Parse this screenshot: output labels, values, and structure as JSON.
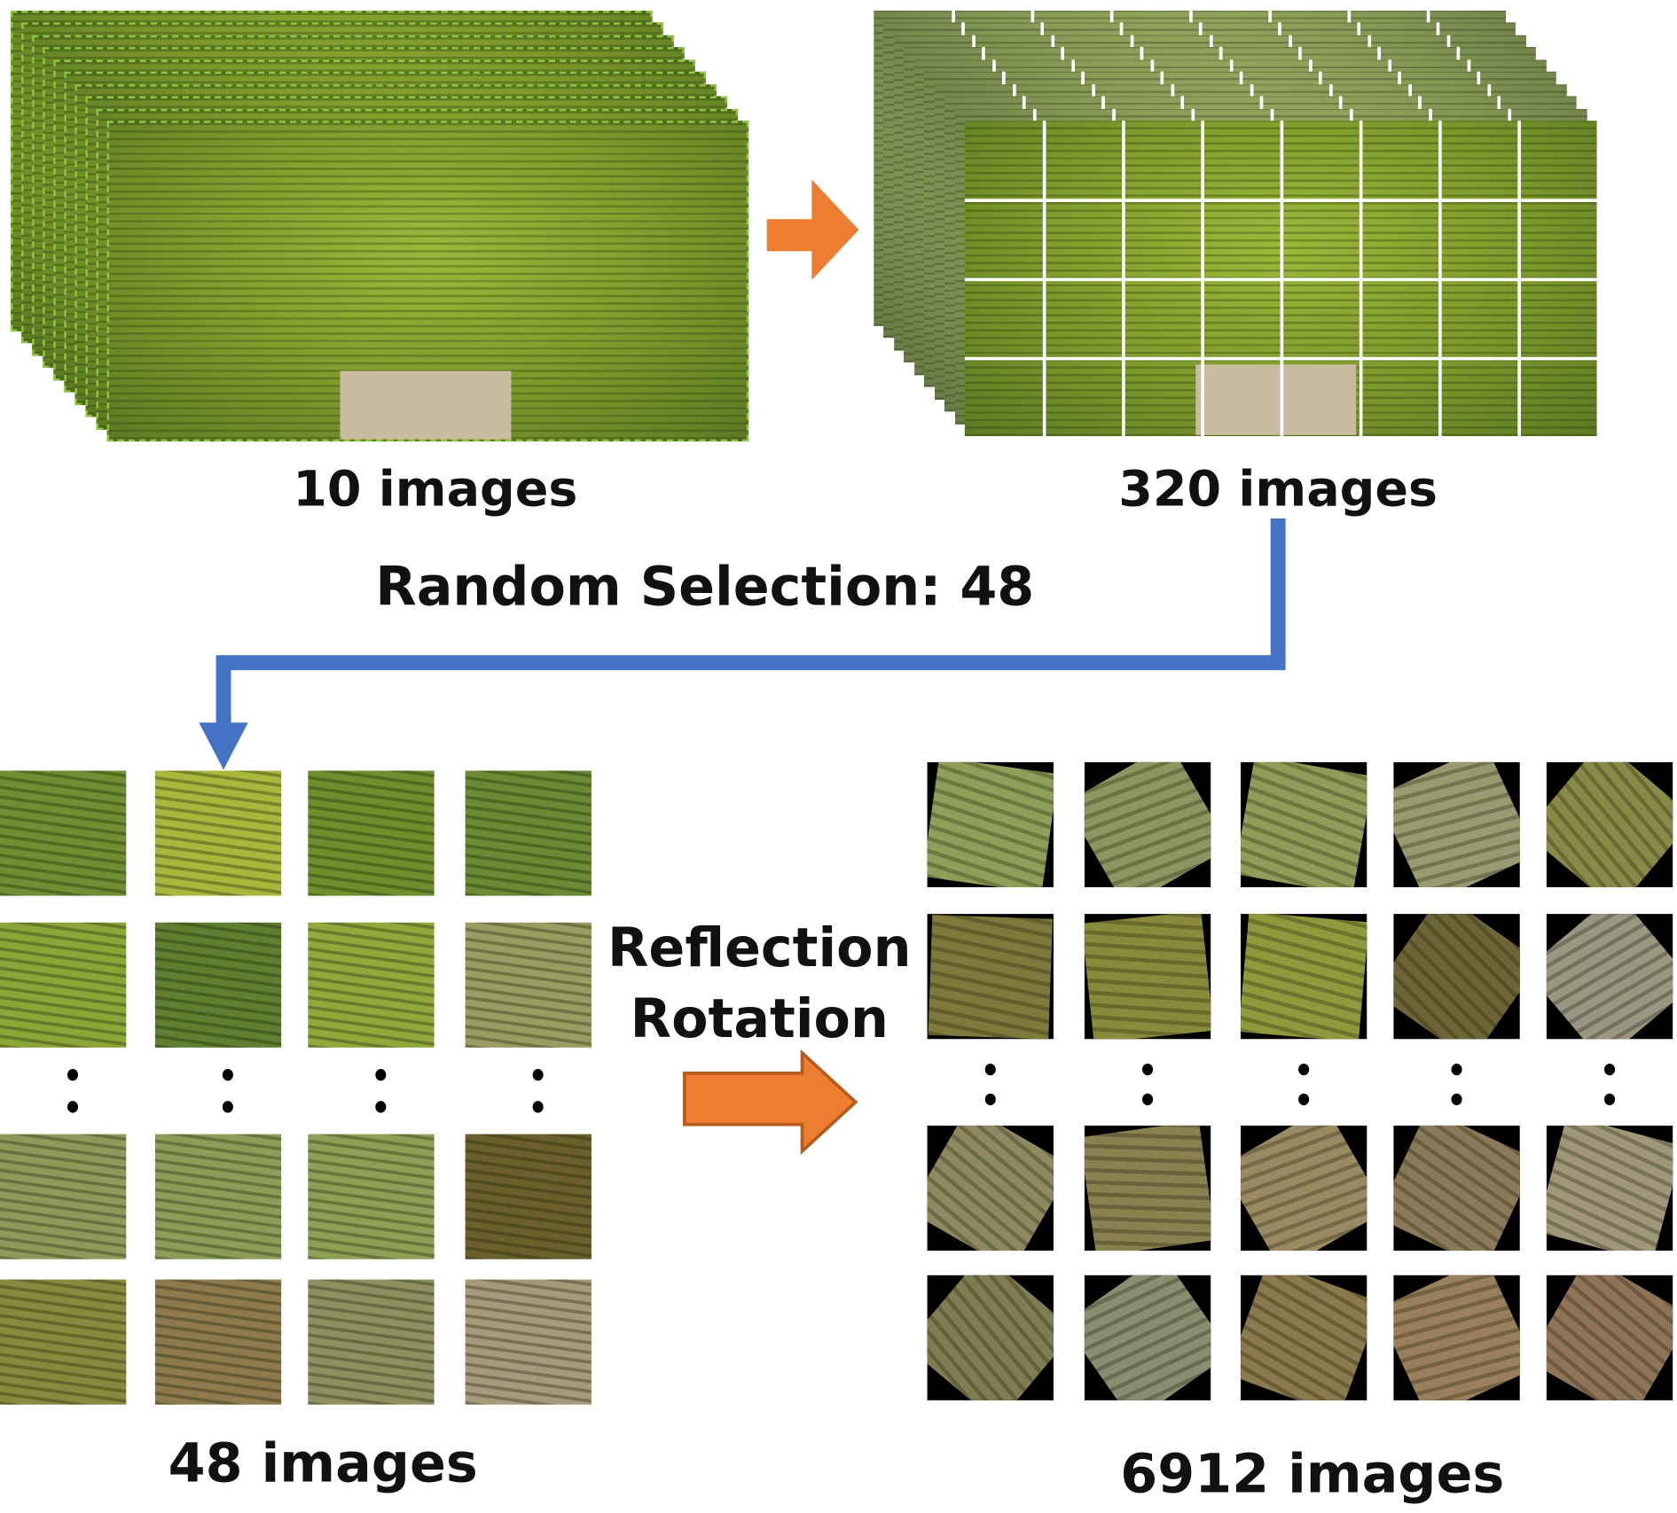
{
  "labels": {
    "source_count": "10 images",
    "cropped_count": "320 images",
    "random_selection": "Random Selection: 48",
    "selected_count": "48 images",
    "augmentation_line1": "Reflection",
    "augmentation_line2": "Rotation",
    "augmented_count": "6912 images"
  },
  "colors": {
    "arrow_orange": "#ed7d31",
    "connector_blue": "#4472c4",
    "stack_border_green": "#8dc63f",
    "grid_line": "#ffffff"
  },
  "selected_tiles": [
    "#6f8f32",
    "#a9b83c",
    "#6d8f2c",
    "#6b8a33",
    "#8aa637",
    "#5f8030",
    "#93a83a",
    "#9a9c62",
    "#8f9a5a",
    "#8c9d58",
    "#8f9f55",
    "#6b5f2c",
    "#8a8a3e",
    "#8f7a4e",
    "#8f9060",
    "#a59a7a"
  ],
  "augmented_tiles": [
    "#8f9e58",
    "#8b9660",
    "#8f9d58",
    "#9a9a70",
    "#8a8a48",
    "#7f7a3c",
    "#8a8a3c",
    "#8f9a3c",
    "#6d6538",
    "#9a9680",
    "#8f8860",
    "#8a8050",
    "#9a8a62",
    "#8a7a58",
    "#a09678",
    "#7f7e52",
    "#8a8e70",
    "#8a7a4c",
    "#9a7f5c",
    "#8f7458"
  ]
}
